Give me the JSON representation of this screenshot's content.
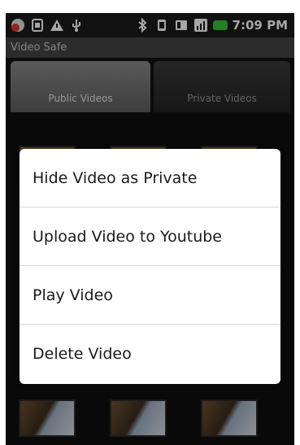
{
  "status_bar": {
    "time": "7:09 PM",
    "icons_left": [
      "notification-count-icon",
      "sim-icon",
      "warning-icon",
      "usb-icon"
    ],
    "icons_right": [
      "bluetooth-icon",
      "vibrate-icon",
      "data-icon",
      "signal-icon",
      "battery-icon"
    ],
    "battery_color": "#38c238"
  },
  "app": {
    "title": "Video Safe"
  },
  "tabs": [
    {
      "label": "Public Videos",
      "selected": true
    },
    {
      "label": "Private Videos",
      "selected": false
    }
  ],
  "context_menu": {
    "items": [
      {
        "label": "Hide Video as Private"
      },
      {
        "label": "Upload Video to Youtube"
      },
      {
        "label": "Play Video"
      },
      {
        "label": "Delete Video"
      }
    ]
  }
}
